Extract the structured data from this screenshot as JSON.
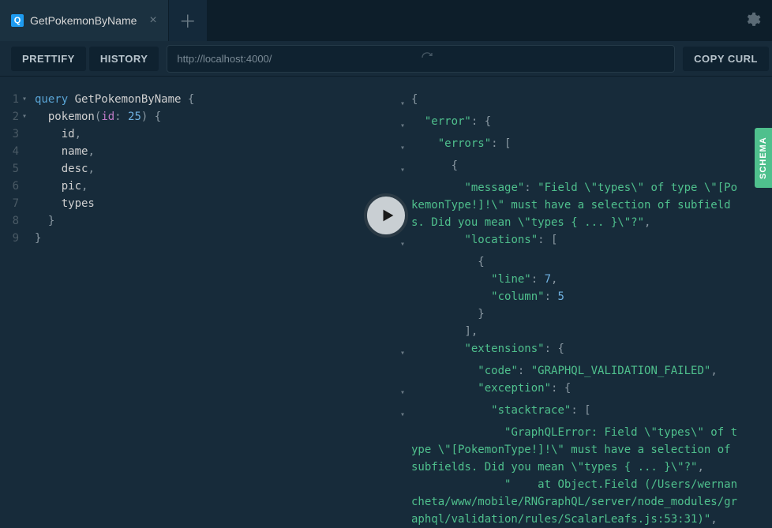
{
  "tab": {
    "icon": "Q",
    "label": "GetPokemonByName"
  },
  "toolbar": {
    "prettify": "PRETTIFY",
    "history": "HISTORY",
    "url": "http://localhost:4000/",
    "copy": "COPY CURL"
  },
  "schema_label": "SCHEMA",
  "editor": {
    "lines": [
      {
        "n": 1,
        "fold": true,
        "tokens": [
          [
            "kw",
            "query "
          ],
          [
            "name",
            "GetPokemonByName"
          ],
          [
            "punc",
            " {"
          ]
        ]
      },
      {
        "n": 2,
        "fold": true,
        "tokens": [
          [
            "plain",
            "  "
          ],
          [
            "name",
            "pokemon"
          ],
          [
            "punc",
            "("
          ],
          [
            "arg",
            "id"
          ],
          [
            "punc",
            ": "
          ],
          [
            "num",
            "25"
          ],
          [
            "punc",
            ") {"
          ]
        ]
      },
      {
        "n": 3,
        "fold": false,
        "tokens": [
          [
            "plain",
            "    "
          ],
          [
            "field",
            "id"
          ],
          [
            "punc",
            ","
          ]
        ]
      },
      {
        "n": 4,
        "fold": false,
        "tokens": [
          [
            "plain",
            "    "
          ],
          [
            "field",
            "name"
          ],
          [
            "punc",
            ","
          ]
        ]
      },
      {
        "n": 5,
        "fold": false,
        "tokens": [
          [
            "plain",
            "    "
          ],
          [
            "field",
            "desc"
          ],
          [
            "punc",
            ","
          ]
        ]
      },
      {
        "n": 6,
        "fold": false,
        "tokens": [
          [
            "plain",
            "    "
          ],
          [
            "field",
            "pic"
          ],
          [
            "punc",
            ","
          ]
        ]
      },
      {
        "n": 7,
        "fold": false,
        "tokens": [
          [
            "plain",
            "    "
          ],
          [
            "field",
            "types"
          ]
        ]
      },
      {
        "n": 8,
        "fold": false,
        "tokens": [
          [
            "plain",
            "  "
          ],
          [
            "punc",
            "}"
          ]
        ]
      },
      {
        "n": 9,
        "fold": false,
        "tokens": [
          [
            "punc",
            "}"
          ]
        ]
      }
    ]
  },
  "result": {
    "lines": [
      {
        "fold": true,
        "frags": [
          [
            "punc",
            "{"
          ]
        ]
      },
      {
        "fold": true,
        "frags": [
          [
            "plain",
            "  "
          ],
          [
            "key",
            "\"error\""
          ],
          [
            "punc",
            ": {"
          ]
        ]
      },
      {
        "fold": true,
        "frags": [
          [
            "plain",
            "    "
          ],
          [
            "key",
            "\"errors\""
          ],
          [
            "punc",
            ": ["
          ]
        ]
      },
      {
        "fold": true,
        "frags": [
          [
            "plain",
            "      "
          ],
          [
            "punc",
            "{"
          ]
        ]
      },
      {
        "fold": false,
        "frags": [
          [
            "plain",
            "        "
          ],
          [
            "key",
            "\"message\""
          ],
          [
            "punc",
            ": "
          ],
          [
            "str",
            "\"Field \\\"types\\\" of type \\\"[PokemonType!]!\\\" must have a selection of subfields. Did you mean \\\"types { ... }\\\"?\""
          ],
          [
            "punc",
            ","
          ]
        ]
      },
      {
        "fold": true,
        "frags": [
          [
            "plain",
            "        "
          ],
          [
            "key",
            "\"locations\""
          ],
          [
            "punc",
            ": ["
          ]
        ]
      },
      {
        "fold": false,
        "frags": [
          [
            "plain",
            "          "
          ],
          [
            "punc",
            "{"
          ]
        ]
      },
      {
        "fold": false,
        "frags": [
          [
            "plain",
            "            "
          ],
          [
            "key",
            "\"line\""
          ],
          [
            "punc",
            ": "
          ],
          [
            "num",
            "7"
          ],
          [
            "punc",
            ","
          ]
        ]
      },
      {
        "fold": false,
        "frags": [
          [
            "plain",
            "            "
          ],
          [
            "key",
            "\"column\""
          ],
          [
            "punc",
            ": "
          ],
          [
            "num",
            "5"
          ]
        ]
      },
      {
        "fold": false,
        "frags": [
          [
            "plain",
            "          "
          ],
          [
            "punc",
            "}"
          ]
        ]
      },
      {
        "fold": false,
        "frags": [
          [
            "plain",
            "        "
          ],
          [
            "punc",
            "],"
          ]
        ]
      },
      {
        "fold": true,
        "frags": [
          [
            "plain",
            "        "
          ],
          [
            "key",
            "\"extensions\""
          ],
          [
            "punc",
            ": {"
          ]
        ]
      },
      {
        "fold": false,
        "frags": [
          [
            "plain",
            "          "
          ],
          [
            "key",
            "\"code\""
          ],
          [
            "punc",
            ": "
          ],
          [
            "str",
            "\"GRAPHQL_VALIDATION_FAILED\""
          ],
          [
            "punc",
            ","
          ]
        ]
      },
      {
        "fold": true,
        "frags": [
          [
            "plain",
            "          "
          ],
          [
            "key",
            "\"exception\""
          ],
          [
            "punc",
            ": {"
          ]
        ]
      },
      {
        "fold": true,
        "frags": [
          [
            "plain",
            "            "
          ],
          [
            "key",
            "\"stacktrace\""
          ],
          [
            "punc",
            ": ["
          ]
        ]
      },
      {
        "fold": false,
        "frags": [
          [
            "plain",
            "              "
          ],
          [
            "str",
            "\"GraphQLError: Field \\\"types\\\" of type \\\"[PokemonType!]!\\\" must have a selection of subfields. Did you mean \\\"types { ... }\\\"?\""
          ],
          [
            "punc",
            ","
          ]
        ]
      },
      {
        "fold": false,
        "frags": [
          [
            "plain",
            "              "
          ],
          [
            "str",
            "\"    at Object.Field (/Users/wernancheta/www/mobile/RNGraphQL/server/node_modules/graphql/validation/rules/ScalarLeafs.js:53:31)\""
          ],
          [
            "punc",
            ","
          ]
        ]
      }
    ]
  }
}
